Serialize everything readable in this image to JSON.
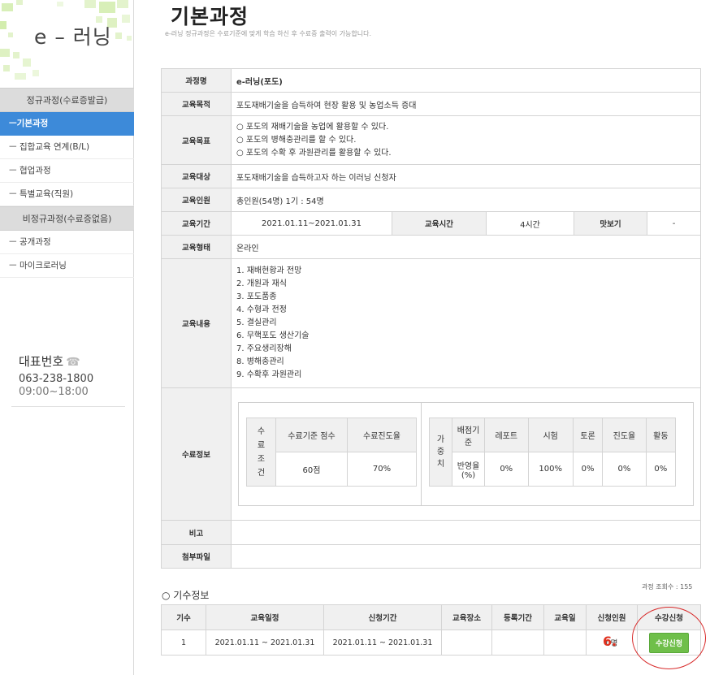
{
  "sidebar": {
    "logo_text": "e – 러닝",
    "sections": [
      {
        "header": "정규과정(수료증발급)",
        "items": [
          {
            "label": "ㅡ기본과정",
            "active": true
          },
          {
            "label": "ㅡ 집합교육 연계(B/L)",
            "active": false
          },
          {
            "label": "ㅡ 협업과정",
            "active": false
          },
          {
            "label": "ㅡ 특별교육(직원)",
            "active": false
          }
        ]
      },
      {
        "header": "비정규과정(수료증없음)",
        "items": [
          {
            "label": "ㅡ 공개과정",
            "active": false
          },
          {
            "label": "ㅡ 마이크로러닝",
            "active": false
          }
        ]
      }
    ],
    "contact": {
      "label": "대표번호",
      "phone_icon": "☎",
      "phone": "063-238-1800",
      "hours": "09:00~18:00"
    }
  },
  "header": {
    "title": "기본과정",
    "subtitle": "e-러닝 정규과정은 수료기준에 맞게 학습 하신 후 수료증 출력이 가능합니다."
  },
  "course": {
    "name_label": "과정명",
    "name": "e-러닝(포도)",
    "purpose_label": "교육목적",
    "purpose": "포도재배기술을 습득하여 현장 활용 및 농업소득 증대",
    "goal_label": "교육목표",
    "goals": [
      "○ 포도의 재배기술을 농업에 활용할 수 있다.",
      "○ 포도의 병해충관리를 할 수 있다.",
      "○ 포도의 수확 후 과원관리를 활용할 수 있다."
    ],
    "target_label": "교육대상",
    "target": "포도재배기술을 습득하고자 하는 이러닝 신청자",
    "capacity_label": "교육인원",
    "capacity": "총인원(54명) 1기 : 54명",
    "period_label": "교육기간",
    "period": "2021.01.11~2021.01.31",
    "hours_label": "교육시간",
    "hours": "4시간",
    "preview_label": "맛보기",
    "preview": "-",
    "format_label": "교육형태",
    "format": "온라인",
    "content_label": "교육내용",
    "contents": [
      "1. 재배현황과 전망",
      "2. 개원과 재식",
      "3. 포도품종",
      "4. 수형과 전정",
      "5. 결실관리",
      "6. 무핵포도 생산기술",
      "7. 주요생리장해",
      "8. 병해충관리",
      "9. 수확후 과원관리"
    ],
    "completion_label": "수료정보",
    "completion": {
      "cond_label": "수료조건",
      "cond_chars": [
        "수",
        "료",
        "조",
        "건"
      ],
      "score_label": "수료기준 점수",
      "score": "60점",
      "progress_label": "수료진도율",
      "progress": "70%"
    },
    "weights": {
      "label_chars": [
        "가",
        "중",
        "치"
      ],
      "criteria_label": "배점기준",
      "reflect_label": "반영율(%)",
      "columns": [
        {
          "name": "레포트",
          "value": "0%"
        },
        {
          "name": "시험",
          "value": "100%"
        },
        {
          "name": "토론",
          "value": "0%"
        },
        {
          "name": "진도율",
          "value": "0%"
        },
        {
          "name": "활동",
          "value": "0%"
        }
      ]
    },
    "note_label": "비고",
    "note": "",
    "attach_label": "첨부파일",
    "attach": ""
  },
  "sessions": {
    "title": "○ 기수정보",
    "view_count": "과정 조회수 : 155",
    "headers": [
      "기수",
      "교육일정",
      "신청기간",
      "교육장소",
      "등록기간",
      "교육일",
      "신청인원",
      "수강신청"
    ],
    "rows": [
      {
        "no": "1",
        "schedule": "2021.01.11 ~ 2021.01.31",
        "apply_period": "2021.01.11 ~ 2021.01.31",
        "place": "",
        "reg_period": "",
        "edu_day": "",
        "applicants": "0명",
        "apply_button": "수강신청"
      }
    ],
    "annotation_number": "6."
  },
  "colors": {
    "accent": "#3d8ad9",
    "button_green": "#6fbf4a",
    "logo_green": "#c8e89a",
    "annotation_red": "#d82a2a"
  }
}
